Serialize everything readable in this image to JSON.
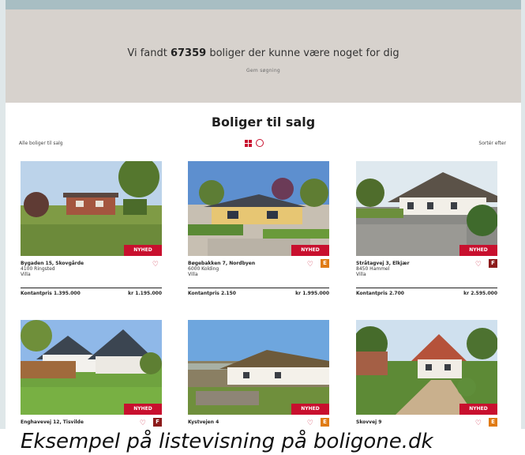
{
  "banner": {
    "prefix": "Vi fandt",
    "count": "67359",
    "suffix": "boliger der kunne være noget for dig",
    "sub": "Gem søgning"
  },
  "listing": {
    "title": "Boliger til salg",
    "filter_left": "Alle boliger til salg",
    "sort_right": "Sortér efter",
    "accent": "#c8102e",
    "badge_orange": "#e07b14",
    "badge_darkred": "#8c1a1a"
  },
  "cards": [
    {
      "tag": "NYHED",
      "address": "Bygaden 15, Skovgårde",
      "zip": "4100 Ringsted",
      "type": "Villa",
      "price_left": "Kontantpris 1.395.000",
      "price_right": "kr 1.195.000",
      "badge": "",
      "badge_color": ""
    },
    {
      "tag": "NYHED",
      "address": "Bøgebakken 7, Nordbyen",
      "zip": "6000 Kolding",
      "type": "Villa",
      "price_left": "Kontantpris 2.150",
      "price_right": "kr 1.995.000",
      "badge": "E",
      "badge_color": "orange"
    },
    {
      "tag": "NYHED",
      "address": "Stråtagvej 3, Elkjær",
      "zip": "8450 Hammel",
      "type": "Villa",
      "price_left": "Kontantpris 2.700",
      "price_right": "kr 2.595.000",
      "badge": "F",
      "badge_color": "darkred"
    },
    {
      "tag": "NYHED",
      "address": "Enghavevej 12, Tisvilde",
      "zip": "",
      "type": "",
      "price_left": "",
      "price_right": "",
      "badge": "F",
      "badge_color": "darkred"
    },
    {
      "tag": "NYHED",
      "address": "Kystvejen 4",
      "zip": "",
      "type": "",
      "price_left": "",
      "price_right": "",
      "badge": "E",
      "badge_color": "orange"
    },
    {
      "tag": "NYHED",
      "address": "Skovvej 9",
      "zip": "",
      "type": "",
      "price_left": "",
      "price_right": "",
      "badge": "E",
      "badge_color": "orange"
    }
  ],
  "caption": "Eksempel på listevisning på boligone.dk"
}
